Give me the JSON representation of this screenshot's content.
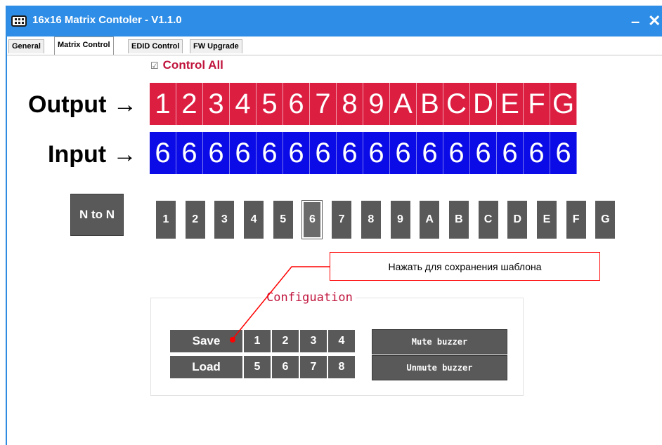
{
  "window": {
    "title": "16x16 Matrix Contoler - V1.1.0",
    "minimize_symbol": "–",
    "close_symbol": "✕",
    "icon": "matrix-app-icon"
  },
  "tabs": [
    {
      "label": "General",
      "active": false
    },
    {
      "label": "Matrix Control",
      "active": true
    },
    {
      "label": "EDID Control",
      "active": false
    },
    {
      "label": "FW Upgrade",
      "active": false
    }
  ],
  "control_all": {
    "checkbox": "☑",
    "label": "Control All",
    "checked": true
  },
  "labels": {
    "output": "Output →",
    "input": "Input →"
  },
  "outputs": [
    "1",
    "2",
    "3",
    "4",
    "5",
    "6",
    "7",
    "8",
    "9",
    "A",
    "B",
    "C",
    "D",
    "E",
    "F",
    "G"
  ],
  "inputs": [
    "6",
    "6",
    "6",
    "6",
    "6",
    "6",
    "6",
    "6",
    "6",
    "6",
    "6",
    "6",
    "6",
    "6",
    "6",
    "6"
  ],
  "ntn_label": "N to N",
  "input_selector": {
    "items": [
      "1",
      "2",
      "3",
      "4",
      "5",
      "6",
      "7",
      "8",
      "9",
      "A",
      "B",
      "C",
      "D",
      "E",
      "F",
      "G"
    ],
    "active": "6"
  },
  "callout": {
    "text": "Нажать для сохранения шаблона"
  },
  "config": {
    "title": "Configuation",
    "save_label": "Save",
    "load_label": "Load",
    "save_slots": [
      "1",
      "2",
      "3",
      "4"
    ],
    "load_slots": [
      "5",
      "6",
      "7",
      "8"
    ],
    "mute_label": "Mute buzzer",
    "unmute_label": "Unmute buzzer"
  },
  "colors": {
    "titlebar": "#2e8de6",
    "output": "#dc1e41",
    "input": "#0b0be8",
    "button": "#595959",
    "accent_red": "#c0143c",
    "callout_border": "#ff0000"
  }
}
